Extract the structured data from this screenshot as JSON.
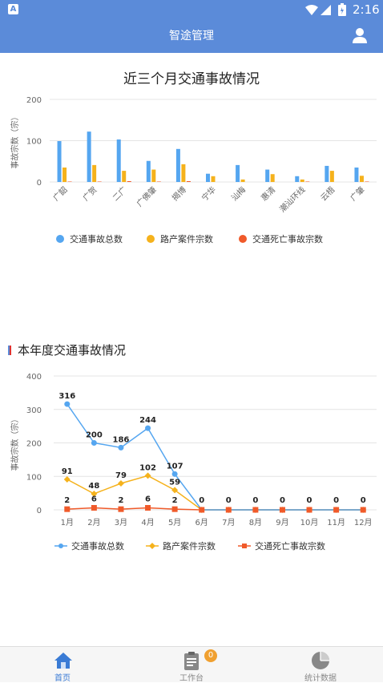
{
  "status": {
    "time": "2:16"
  },
  "header": {
    "title": "智途管理"
  },
  "chart1": {
    "title": "近三个月交通事故情况",
    "ylabel": "事故宗数（宗）",
    "legend": [
      "交通事故总数",
      "路产案件宗数",
      "交通死亡事故宗数"
    ]
  },
  "chart2": {
    "title": "本年度交通事故情况",
    "ylabel": "事故宗数（宗）",
    "legend": [
      "交通事故总数",
      "路产案件宗数",
      "交通死亡事故宗数"
    ]
  },
  "colors": {
    "blue": "#55a6f0",
    "orange": "#f5b21c",
    "red": "#f05a2a",
    "header": "#5b8bd9"
  },
  "tabs": [
    {
      "label": "首页",
      "icon": "home-icon",
      "active": true
    },
    {
      "label": "工作台",
      "icon": "clipboard-icon",
      "badge": "0"
    },
    {
      "label": "统计数据",
      "icon": "pie-chart-icon"
    }
  ],
  "chart_data": [
    {
      "type": "bar",
      "title": "近三个月交通事故情况",
      "ylabel": "事故宗数（宗）",
      "ylim": [
        0,
        200
      ],
      "yticks": [
        0,
        100,
        200
      ],
      "legend_position": "bottom",
      "categories": [
        "广韶",
        "广贺",
        "二广",
        "广佛肇",
        "揭博",
        "宁华",
        "汕梅",
        "惠清",
        "潮汕环线",
        "云梧",
        "广肇"
      ],
      "series": [
        {
          "name": "交通事故总数",
          "values": [
            99,
            122,
            103,
            51,
            80,
            20,
            41,
            30,
            14,
            39,
            35
          ]
        },
        {
          "name": "路产案件宗数",
          "values": [
            35,
            41,
            27,
            30,
            43,
            14,
            6,
            19,
            6,
            27,
            15
          ]
        },
        {
          "name": "交通死亡事故宗数",
          "values": [
            1,
            1,
            2,
            1,
            2,
            0,
            0,
            0,
            1,
            0,
            1
          ]
        }
      ]
    },
    {
      "type": "line",
      "title": "本年度交通事故情况",
      "ylabel": "事故宗数（宗）",
      "ylim": [
        0,
        400
      ],
      "yticks": [
        0,
        100,
        200,
        300,
        400
      ],
      "legend_position": "bottom",
      "categories": [
        "1月",
        "2月",
        "3月",
        "4月",
        "5月",
        "6月",
        "7月",
        "8月",
        "9月",
        "10月",
        "11月",
        "12月"
      ],
      "series": [
        {
          "name": "交通事故总数",
          "values": [
            316,
            200,
            186,
            244,
            107,
            0,
            0,
            0,
            0,
            0,
            0,
            0
          ]
        },
        {
          "name": "路产案件宗数",
          "values": [
            91,
            48,
            79,
            102,
            59,
            0,
            0,
            0,
            0,
            0,
            0,
            0
          ]
        },
        {
          "name": "交通死亡事故宗数",
          "values": [
            2,
            6,
            2,
            6,
            2,
            0,
            0,
            0,
            0,
            0,
            0,
            0
          ]
        }
      ]
    }
  ]
}
